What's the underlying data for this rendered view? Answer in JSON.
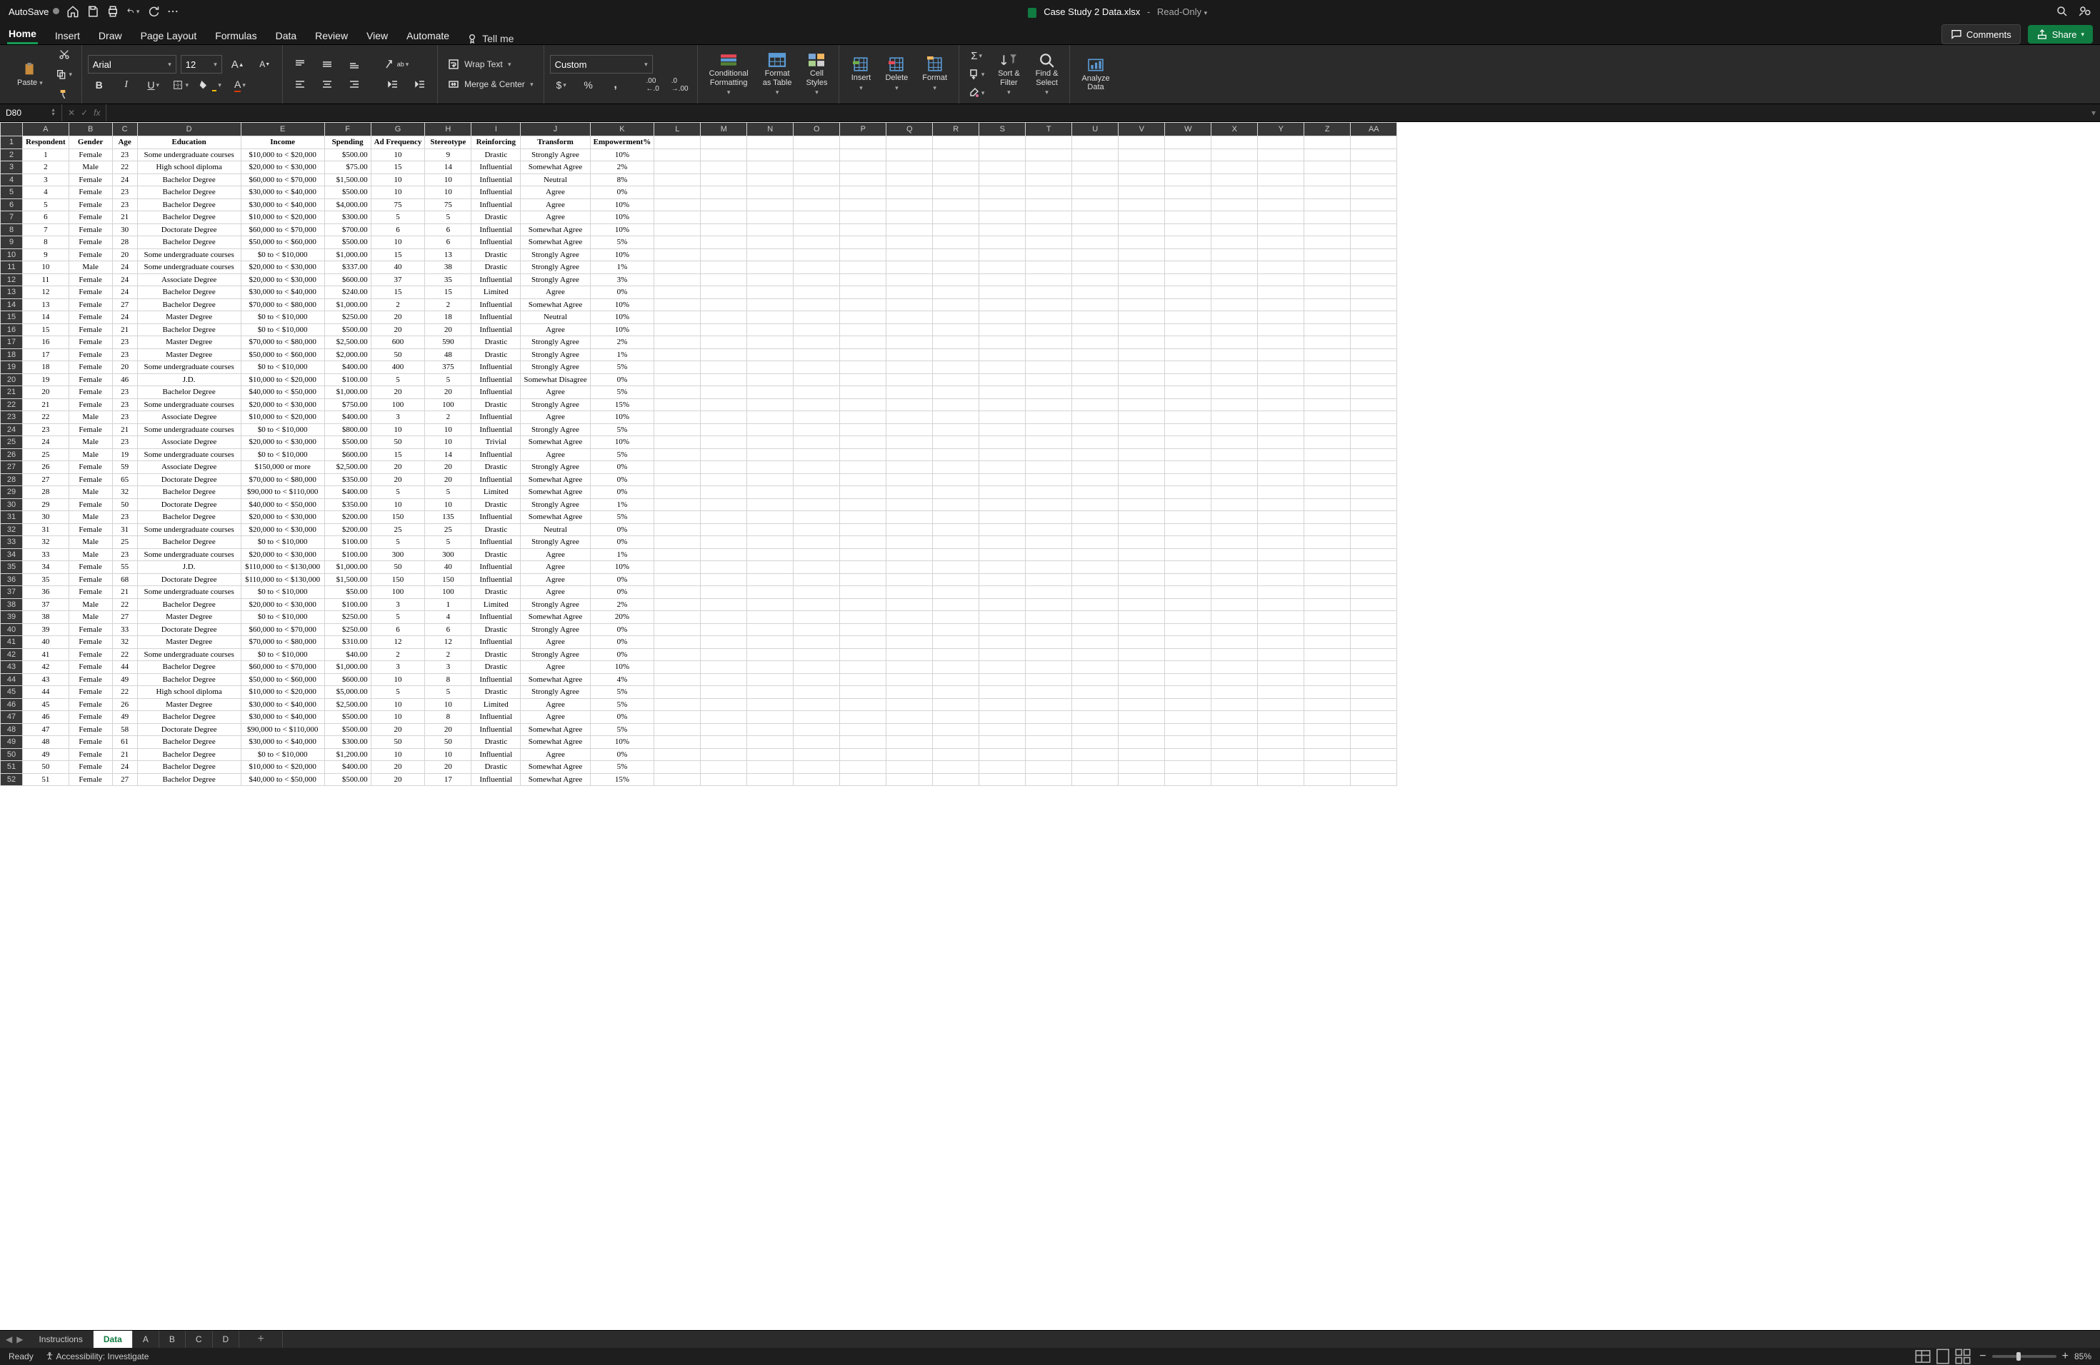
{
  "title": {
    "autosave": "AutoSave",
    "filename": "Case Study 2 Data.xlsx",
    "readonly": "Read-Only"
  },
  "ribbonTabs": [
    "Home",
    "Insert",
    "Draw",
    "Page Layout",
    "Formulas",
    "Data",
    "Review",
    "View",
    "Automate"
  ],
  "tellme": "Tell me",
  "comments": "Comments",
  "share": "Share",
  "font": {
    "name": "Arial",
    "size": "12"
  },
  "wrap": "Wrap Text",
  "merge": "Merge & Center",
  "numfmt": "Custom",
  "big": {
    "paste": "Paste",
    "condfmt": "Conditional\nFormatting",
    "fmttbl": "Format\nas Table",
    "cellstyles": "Cell\nStyles",
    "insert": "Insert",
    "delete": "Delete",
    "format": "Format",
    "sortfilter": "Sort &\nFilter",
    "findselect": "Find &\nSelect",
    "analyze": "Analyze\nData"
  },
  "namebox": "D80",
  "colHeaders": [
    "A",
    "B",
    "C",
    "D",
    "E",
    "F",
    "G",
    "H",
    "I",
    "J",
    "K",
    "L",
    "M",
    "N",
    "O",
    "P",
    "Q",
    "R",
    "S",
    "T",
    "U",
    "V",
    "W",
    "X",
    "Y",
    "Z",
    "AA"
  ],
  "dataHeaders": [
    "Respondent",
    "Gender",
    "Age",
    "Education",
    "Income",
    "Spending",
    "Ad Frequency",
    "Stereotype",
    "Reinforcing",
    "Transform",
    "Empowerment%"
  ],
  "rows": [
    [
      "1",
      "Female",
      "23",
      "Some undergraduate courses",
      "$10,000 to < $20,000",
      "$500.00",
      "10",
      "9",
      "Drastic",
      "Strongly Agree",
      "10%"
    ],
    [
      "2",
      "Male",
      "22",
      "High school diploma",
      "$20,000 to < $30,000",
      "$75.00",
      "15",
      "14",
      "Influential",
      "Somewhat Agree",
      "2%"
    ],
    [
      "3",
      "Female",
      "24",
      "Bachelor Degree",
      "$60,000 to < $70,000",
      "$1,500.00",
      "10",
      "10",
      "Influential",
      "Neutral",
      "8%"
    ],
    [
      "4",
      "Female",
      "23",
      "Bachelor Degree",
      "$30,000 to < $40,000",
      "$500.00",
      "10",
      "10",
      "Influential",
      "Agree",
      "0%"
    ],
    [
      "5",
      "Female",
      "23",
      "Bachelor Degree",
      "$30,000 to < $40,000",
      "$4,000.00",
      "75",
      "75",
      "Influential",
      "Agree",
      "10%"
    ],
    [
      "6",
      "Female",
      "21",
      "Bachelor Degree",
      "$10,000 to < $20,000",
      "$300.00",
      "5",
      "5",
      "Drastic",
      "Agree",
      "10%"
    ],
    [
      "7",
      "Female",
      "30",
      "Doctorate Degree",
      "$60,000 to < $70,000",
      "$700.00",
      "6",
      "6",
      "Influential",
      "Somewhat Agree",
      "10%"
    ],
    [
      "8",
      "Female",
      "28",
      "Bachelor Degree",
      "$50,000 to < $60,000",
      "$500.00",
      "10",
      "6",
      "Influential",
      "Somewhat Agree",
      "5%"
    ],
    [
      "9",
      "Female",
      "20",
      "Some undergraduate courses",
      "$0 to < $10,000",
      "$1,000.00",
      "15",
      "13",
      "Drastic",
      "Strongly Agree",
      "10%"
    ],
    [
      "10",
      "Male",
      "24",
      "Some undergraduate courses",
      "$20,000 to < $30,000",
      "$337.00",
      "40",
      "38",
      "Drastic",
      "Strongly Agree",
      "1%"
    ],
    [
      "11",
      "Female",
      "24",
      "Associate Degree",
      "$20,000 to < $30,000",
      "$600.00",
      "37",
      "35",
      "Influential",
      "Strongly Agree",
      "3%"
    ],
    [
      "12",
      "Female",
      "24",
      "Bachelor Degree",
      "$30,000 to < $40,000",
      "$240.00",
      "15",
      "15",
      "Limited",
      "Agree",
      "0%"
    ],
    [
      "13",
      "Female",
      "27",
      "Bachelor Degree",
      "$70,000 to < $80,000",
      "$1,000.00",
      "2",
      "2",
      "Influential",
      "Somewhat Agree",
      "10%"
    ],
    [
      "14",
      "Female",
      "24",
      "Master Degree",
      "$0 to < $10,000",
      "$250.00",
      "20",
      "18",
      "Influential",
      "Neutral",
      "10%"
    ],
    [
      "15",
      "Female",
      "21",
      "Bachelor Degree",
      "$0 to < $10,000",
      "$500.00",
      "20",
      "20",
      "Influential",
      "Agree",
      "10%"
    ],
    [
      "16",
      "Female",
      "23",
      "Master Degree",
      "$70,000 to < $80,000",
      "$2,500.00",
      "600",
      "590",
      "Drastic",
      "Strongly Agree",
      "2%"
    ],
    [
      "17",
      "Female",
      "23",
      "Master Degree",
      "$50,000 to < $60,000",
      "$2,000.00",
      "50",
      "48",
      "Drastic",
      "Strongly Agree",
      "1%"
    ],
    [
      "18",
      "Female",
      "20",
      "Some undergraduate courses",
      "$0 to < $10,000",
      "$400.00",
      "400",
      "375",
      "Influential",
      "Strongly Agree",
      "5%"
    ],
    [
      "19",
      "Female",
      "46",
      "J.D.",
      "$10,000 to < $20,000",
      "$100.00",
      "5",
      "5",
      "Influential",
      "Somewhat Disagree",
      "0%"
    ],
    [
      "20",
      "Female",
      "23",
      "Bachelor Degree",
      "$40,000 to < $50,000",
      "$1,000.00",
      "20",
      "20",
      "Influential",
      "Agree",
      "5%"
    ],
    [
      "21",
      "Female",
      "23",
      "Some undergraduate courses",
      "$20,000 to < $30,000",
      "$750.00",
      "100",
      "100",
      "Drastic",
      "Strongly Agree",
      "15%"
    ],
    [
      "22",
      "Male",
      "23",
      "Associate Degree",
      "$10,000 to < $20,000",
      "$400.00",
      "3",
      "2",
      "Influential",
      "Agree",
      "10%"
    ],
    [
      "23",
      "Female",
      "21",
      "Some undergraduate courses",
      "$0 to < $10,000",
      "$800.00",
      "10",
      "10",
      "Influential",
      "Strongly Agree",
      "5%"
    ],
    [
      "24",
      "Male",
      "23",
      "Associate Degree",
      "$20,000 to < $30,000",
      "$500.00",
      "50",
      "10",
      "Trivial",
      "Somewhat Agree",
      "10%"
    ],
    [
      "25",
      "Male",
      "19",
      "Some undergraduate courses",
      "$0 to < $10,000",
      "$600.00",
      "15",
      "14",
      "Influential",
      "Agree",
      "5%"
    ],
    [
      "26",
      "Female",
      "59",
      "Associate Degree",
      "$150,000 or more",
      "$2,500.00",
      "20",
      "20",
      "Drastic",
      "Strongly Agree",
      "0%"
    ],
    [
      "27",
      "Female",
      "65",
      "Doctorate Degree",
      "$70,000 to < $80,000",
      "$350.00",
      "20",
      "20",
      "Influential",
      "Somewhat Agree",
      "0%"
    ],
    [
      "28",
      "Male",
      "32",
      "Bachelor Degree",
      "$90,000 to < $110,000",
      "$400.00",
      "5",
      "5",
      "Limited",
      "Somewhat Agree",
      "0%"
    ],
    [
      "29",
      "Female",
      "50",
      "Doctorate Degree",
      "$40,000 to < $50,000",
      "$350.00",
      "10",
      "10",
      "Drastic",
      "Strongly Agree",
      "1%"
    ],
    [
      "30",
      "Male",
      "23",
      "Bachelor Degree",
      "$20,000 to < $30,000",
      "$200.00",
      "150",
      "135",
      "Influential",
      "Somewhat Agree",
      "5%"
    ],
    [
      "31",
      "Female",
      "31",
      "Some undergraduate courses",
      "$20,000 to < $30,000",
      "$200.00",
      "25",
      "25",
      "Drastic",
      "Neutral",
      "0%"
    ],
    [
      "32",
      "Male",
      "25",
      "Bachelor Degree",
      "$0 to < $10,000",
      "$100.00",
      "5",
      "5",
      "Influential",
      "Strongly Agree",
      "0%"
    ],
    [
      "33",
      "Male",
      "23",
      "Some undergraduate courses",
      "$20,000 to < $30,000",
      "$100.00",
      "300",
      "300",
      "Drastic",
      "Agree",
      "1%"
    ],
    [
      "34",
      "Female",
      "55",
      "J.D.",
      "$110,000 to < $130,000",
      "$1,000.00",
      "50",
      "40",
      "Influential",
      "Agree",
      "10%"
    ],
    [
      "35",
      "Female",
      "68",
      "Doctorate Degree",
      "$110,000 to < $130,000",
      "$1,500.00",
      "150",
      "150",
      "Influential",
      "Agree",
      "0%"
    ],
    [
      "36",
      "Female",
      "21",
      "Some undergraduate courses",
      "$0 to < $10,000",
      "$50.00",
      "100",
      "100",
      "Drastic",
      "Agree",
      "0%"
    ],
    [
      "37",
      "Male",
      "22",
      "Bachelor Degree",
      "$20,000 to < $30,000",
      "$100.00",
      "3",
      "1",
      "Limited",
      "Strongly Agree",
      "2%"
    ],
    [
      "38",
      "Male",
      "27",
      "Master Degree",
      "$0 to < $10,000",
      "$250.00",
      "5",
      "4",
      "Influential",
      "Somewhat Agree",
      "20%"
    ],
    [
      "39",
      "Female",
      "33",
      "Doctorate Degree",
      "$60,000 to < $70,000",
      "$250.00",
      "6",
      "6",
      "Drastic",
      "Strongly Agree",
      "0%"
    ],
    [
      "40",
      "Female",
      "32",
      "Master Degree",
      "$70,000 to < $80,000",
      "$310.00",
      "12",
      "12",
      "Influential",
      "Agree",
      "0%"
    ],
    [
      "41",
      "Female",
      "22",
      "Some undergraduate courses",
      "$0 to < $10,000",
      "$40.00",
      "2",
      "2",
      "Drastic",
      "Strongly Agree",
      "0%"
    ],
    [
      "42",
      "Female",
      "44",
      "Bachelor Degree",
      "$60,000 to < $70,000",
      "$1,000.00",
      "3",
      "3",
      "Drastic",
      "Agree",
      "10%"
    ],
    [
      "43",
      "Female",
      "49",
      "Bachelor Degree",
      "$50,000 to < $60,000",
      "$600.00",
      "10",
      "8",
      "Influential",
      "Somewhat Agree",
      "4%"
    ],
    [
      "44",
      "Female",
      "22",
      "High school diploma",
      "$10,000 to < $20,000",
      "$5,000.00",
      "5",
      "5",
      "Drastic",
      "Strongly Agree",
      "5%"
    ],
    [
      "45",
      "Female",
      "26",
      "Master Degree",
      "$30,000 to < $40,000",
      "$2,500.00",
      "10",
      "10",
      "Limited",
      "Agree",
      "5%"
    ],
    [
      "46",
      "Female",
      "49",
      "Bachelor Degree",
      "$30,000 to < $40,000",
      "$500.00",
      "10",
      "8",
      "Influential",
      "Agree",
      "0%"
    ],
    [
      "47",
      "Female",
      "58",
      "Doctorate Degree",
      "$90,000 to < $110,000",
      "$500.00",
      "20",
      "20",
      "Influential",
      "Somewhat Agree",
      "5%"
    ],
    [
      "48",
      "Female",
      "61",
      "Bachelor Degree",
      "$30,000 to < $40,000",
      "$300.00",
      "50",
      "50",
      "Drastic",
      "Somewhat Agree",
      "10%"
    ],
    [
      "49",
      "Female",
      "21",
      "Bachelor Degree",
      "$0 to < $10,000",
      "$1,200.00",
      "10",
      "10",
      "Influential",
      "Agree",
      "0%"
    ],
    [
      "50",
      "Female",
      "24",
      "Bachelor Degree",
      "$10,000 to < $20,000",
      "$400.00",
      "20",
      "20",
      "Drastic",
      "Somewhat Agree",
      "5%"
    ],
    [
      "51",
      "Female",
      "27",
      "Bachelor Degree",
      "$40,000 to < $50,000",
      "$500.00",
      "20",
      "17",
      "Influential",
      "Somewhat Agree",
      "15%"
    ]
  ],
  "sheetTabs": [
    "Instructions",
    "Data",
    "A",
    "B",
    "C",
    "D"
  ],
  "status": {
    "ready": "Ready",
    "accessibility": "Accessibility: Investigate",
    "zoom": "85%"
  }
}
